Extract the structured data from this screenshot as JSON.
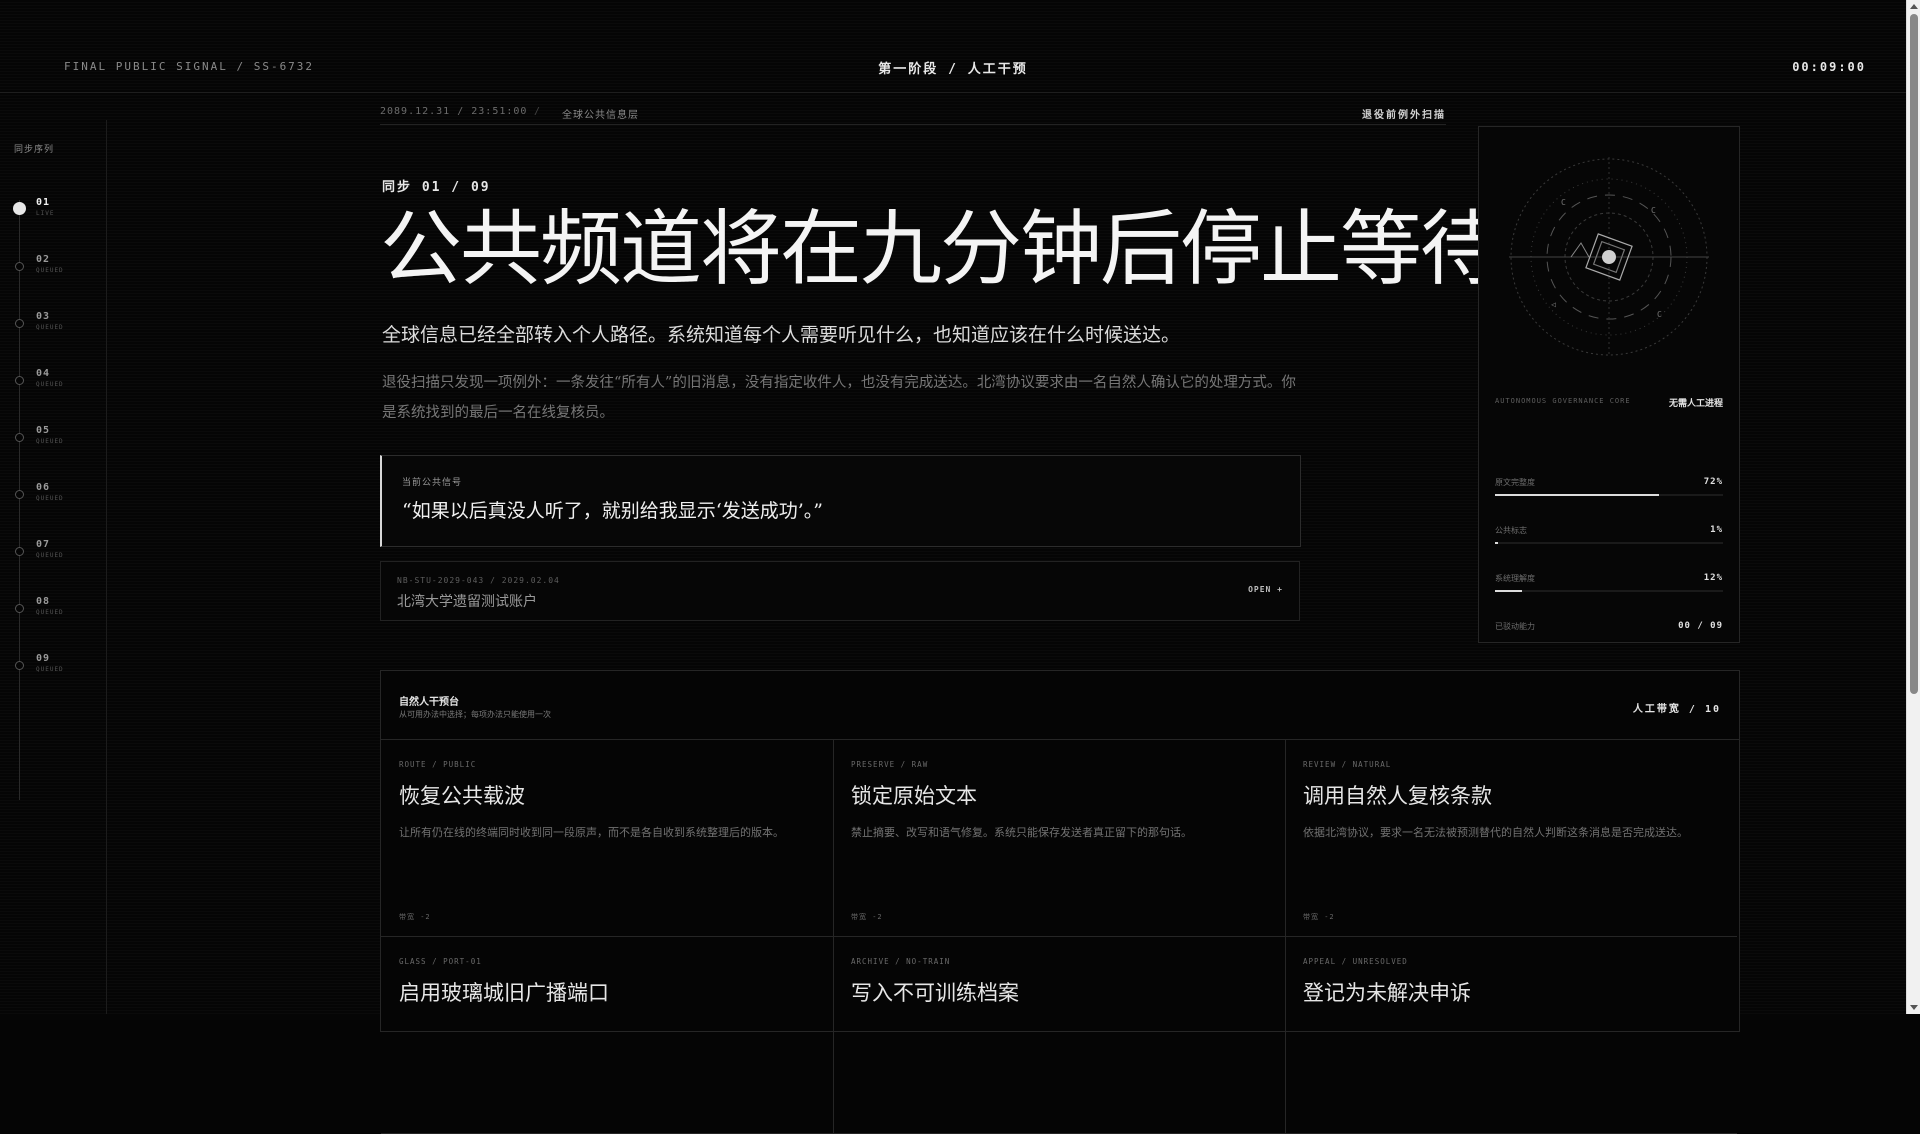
{
  "header": {
    "left": "FINAL PUBLIC SIGNAL / SS-6732",
    "center": "第一阶段 / 人工干预",
    "timer": "00:09:00"
  },
  "sidebar": {
    "title": "同步序列",
    "steps": [
      {
        "num": "01",
        "status": "LIVE",
        "active": true
      },
      {
        "num": "02",
        "status": "QUEUED"
      },
      {
        "num": "03",
        "status": "QUEUED"
      },
      {
        "num": "04",
        "status": "QUEUED"
      },
      {
        "num": "05",
        "status": "QUEUED"
      },
      {
        "num": "06",
        "status": "QUEUED"
      },
      {
        "num": "07",
        "status": "QUEUED"
      },
      {
        "num": "08",
        "status": "QUEUED"
      },
      {
        "num": "09",
        "status": "QUEUED"
      }
    ]
  },
  "meta": {
    "datetime": "2089.12.31 / 23:51:00",
    "sep": "/",
    "layer": "全球公共信息层",
    "scan": "退役前例外扫描"
  },
  "main": {
    "sync": "同步 01 / 09",
    "headline": "公共频道将在九分钟后停止等待",
    "sub": "全球信息已经全部转入个人路径。系统知道每个人需要听见什么，也知道应该在什么时候送达。",
    "desc": "退役扫描只发现一项例外：一条发往“所有人”的旧消息，没有指定收件人，也没有完成送达。北湾协议要求由一名自然人确认它的处理方式。你是系统找到的最后一名在线复核员。"
  },
  "signal": {
    "label": "当前公共信号",
    "quote": "“如果以后真没人听了，就别给我显示‘发送成功’。”"
  },
  "account": {
    "id": "NB-STU-2029-043 / 2029.02.04",
    "name": "北湾大学遗留测试账户",
    "open": "OPEN +"
  },
  "panel": {
    "gov_label": "AUTONOMOUS GOVERNANCE CORE",
    "gov_value": "无需人工进程",
    "stats": [
      {
        "label": "原文完整度",
        "value": "72%",
        "pct": 72
      },
      {
        "label": "公共标志",
        "value": "1%",
        "pct": 1
      },
      {
        "label": "系统理解度",
        "value": "12%",
        "pct": 12
      },
      {
        "label": "已驳动能力",
        "value": "00 / 09",
        "pct": 0
      }
    ]
  },
  "desk": {
    "title": "自然人干预台",
    "sub": "从可用办法中选择；每项办法只能使用一次",
    "bandwidth": "人工带宽 / 10",
    "cards": [
      {
        "tag": "ROUTE / PUBLIC",
        "title": "恢复公共载波",
        "text": "让所有仍在线的终端同时收到同一段原声，而不是各自收到系统整理后的版本。",
        "cost": "带宽 -2"
      },
      {
        "tag": "PRESERVE / RAW",
        "title": "锁定原始文本",
        "text": "禁止摘要、改写和语气修复。系统只能保存发送者真正留下的那句话。",
        "cost": "带宽 -2"
      },
      {
        "tag": "REVIEW / NATURAL",
        "title": "调用自然人复核条款",
        "text": "依据北湾协议，要求一名无法被预测替代的自然人判断这条消息是否完成送达。",
        "cost": "带宽 -2"
      },
      {
        "tag": "GLASS / PORT-01",
        "title": "启用玻璃城旧广播端口",
        "text": "",
        "cost": ""
      },
      {
        "tag": "ARCHIVE / NO-TRAIN",
        "title": "写入不可训练档案",
        "text": "",
        "cost": ""
      },
      {
        "tag": "APPEAL / UNRESOLVED",
        "title": "登记为未解决申诉",
        "text": "",
        "cost": ""
      }
    ]
  }
}
